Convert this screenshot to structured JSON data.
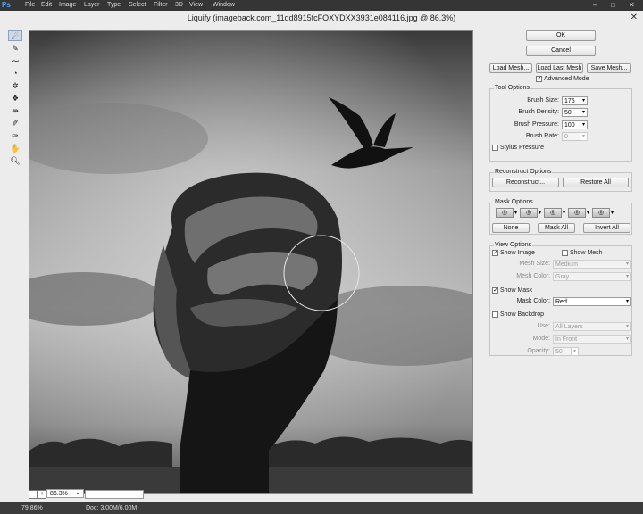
{
  "app": {
    "logo": "Ps"
  },
  "menubar": {
    "items": [
      "File",
      "Edit",
      "Image",
      "Layer",
      "Type",
      "Select",
      "Filter",
      "3D",
      "View",
      "Window"
    ]
  },
  "window_controls": {
    "minimize": "–",
    "maximize": "□",
    "close": "✕"
  },
  "dialog": {
    "title": "Liquify (imageback.com_11dd8915fcFOXYDXX3931e084116.jpg @ 86.3%)",
    "close_glyph": "✕"
  },
  "canvas_footer": {
    "zoom": "86.3%",
    "zoom_out": "−",
    "zoom_in": "+",
    "dropdown": "⌄"
  },
  "tools": [
    {
      "name": "forward-warp-tool-icon",
      "glyph": "☄"
    },
    {
      "name": "reconstruct-tool-icon",
      "glyph": "✎"
    },
    {
      "name": "smooth-tool-icon",
      "glyph": "⁓"
    },
    {
      "name": "twirl-clockwise-tool-icon",
      "glyph": "◔"
    },
    {
      "name": "pucker-tool-icon",
      "glyph": "✲"
    },
    {
      "name": "bloat-tool-icon",
      "glyph": "❖"
    },
    {
      "name": "push-left-tool-icon",
      "glyph": "⇹"
    },
    {
      "name": "freeze-mask-tool-icon",
      "glyph": "✐"
    },
    {
      "name": "thaw-mask-tool-icon",
      "glyph": "✑"
    },
    {
      "name": "hand-tool-icon",
      "glyph": "✋"
    },
    {
      "name": "zoom-tool-icon",
      "glyph": "🔍︎"
    }
  ],
  "panel": {
    "ok": "OK",
    "cancel": "Cancel",
    "load_mesh": "Load Mesh...",
    "load_last_mesh": "Load Last Mesh",
    "save_mesh": "Save Mesh...",
    "advanced_mode": {
      "label": "Advanced Mode",
      "checked": true
    },
    "tool_options": {
      "title": "Tool Options",
      "brush_size": {
        "label": "Brush Size:",
        "value": "175"
      },
      "brush_density": {
        "label": "Brush Density:",
        "value": "50"
      },
      "brush_pressure": {
        "label": "Brush Pressure:",
        "value": "100"
      },
      "brush_rate": {
        "label": "Brush Rate:",
        "value": "0"
      },
      "stylus_pressure": {
        "label": "Stylus Pressure",
        "checked": false
      }
    },
    "reconstruct_options": {
      "title": "Reconstruct Options",
      "reconstruct": "Reconstruct...",
      "restore_all": "Restore All"
    },
    "mask_options": {
      "title": "Mask Options",
      "none": "None",
      "mask_all": "Mask All",
      "invert_all": "Invert All"
    },
    "view_options": {
      "title": "View Options",
      "show_image": {
        "label": "Show Image",
        "checked": true
      },
      "show_mesh": {
        "label": "Show Mesh",
        "checked": false
      },
      "mesh_size": {
        "label": "Mesh Size:",
        "value": "Medium"
      },
      "mesh_color": {
        "label": "Mesh Color:",
        "value": "Gray"
      },
      "show_mask": {
        "label": "Show Mask",
        "checked": true
      },
      "mask_color": {
        "label": "Mask Color:",
        "value": "Red"
      },
      "show_backdrop": {
        "label": "Show Backdrop",
        "checked": false
      },
      "use": {
        "label": "Use:",
        "value": "All Layers"
      },
      "mode": {
        "label": "Mode:",
        "value": "In Front"
      },
      "opacity": {
        "label": "Opacity:",
        "value": "50"
      }
    }
  },
  "statusbar": {
    "zoom": "79.86%",
    "doc": "Doc: 3.00M/6.00M"
  }
}
